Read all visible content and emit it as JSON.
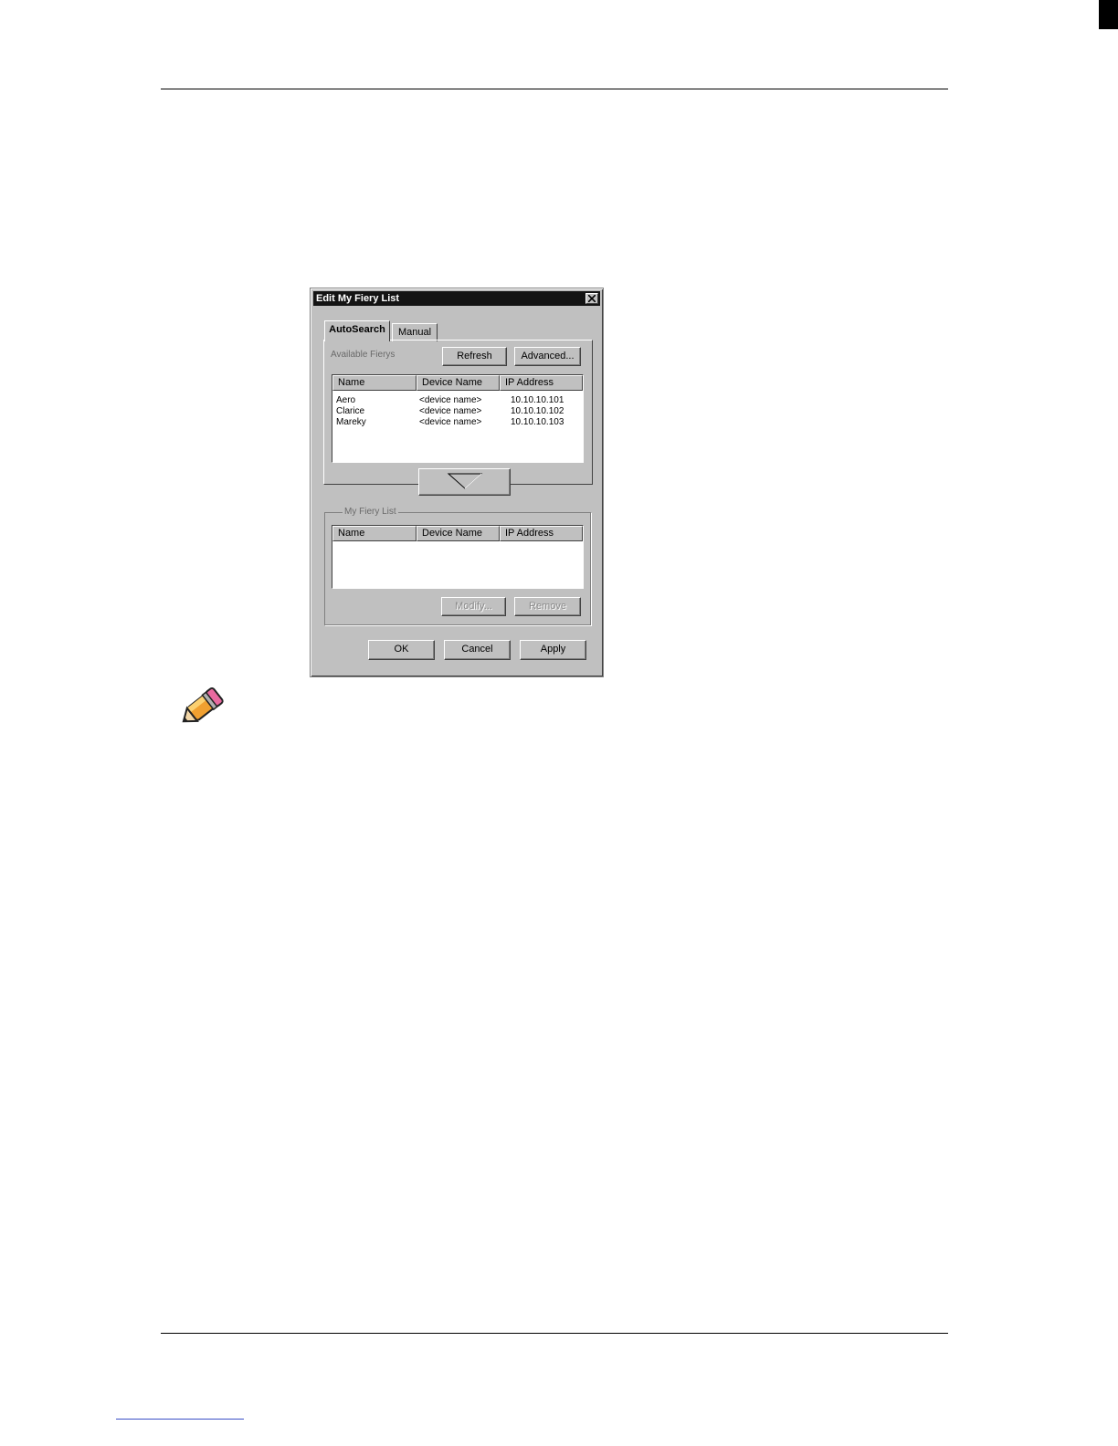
{
  "dialog": {
    "title": "Edit My Fiery List",
    "tabs": [
      {
        "label": "AutoSearch",
        "active": true
      },
      {
        "label": "Manual",
        "active": false
      }
    ],
    "available_label": "Available Fierys",
    "refresh_label": "Refresh",
    "advanced_label": "Advanced...",
    "columns": [
      "Name",
      "Device Name",
      "IP Address"
    ],
    "available_rows": [
      {
        "name": "Aero",
        "device": "<device name>",
        "ip": "10.10.10.101"
      },
      {
        "name": "Clarice",
        "device": "<device name>",
        "ip": "10.10.10.102"
      },
      {
        "name": "Mareky",
        "device": "<device name>",
        "ip": "10.10.10.103"
      }
    ],
    "my_list_label": "My Fiery List",
    "modify_label": "Modify...",
    "remove_label": "Remove",
    "ok_label": "OK",
    "cancel_label": "Cancel",
    "apply_label": "Apply"
  },
  "icons": {
    "close": "close-icon",
    "add_arrow": "triangle-down-icon",
    "note": "pencil-icon"
  }
}
